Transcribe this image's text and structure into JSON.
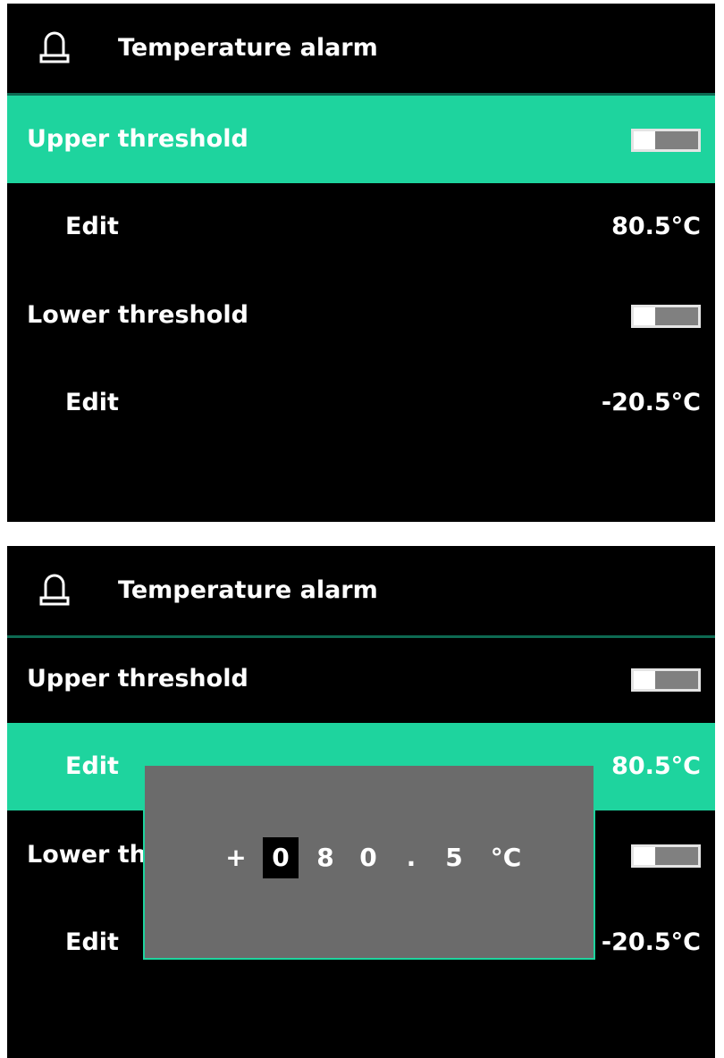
{
  "screens": [
    {
      "header": {
        "title": "Temperature alarm",
        "icon": "bell-icon"
      },
      "rows": [
        {
          "label": "Upper threshold",
          "type": "toggle",
          "enabled": false,
          "active": true
        },
        {
          "label": "Edit",
          "type": "value",
          "value": "80.5°C",
          "active": false
        },
        {
          "label": "Lower threshold",
          "type": "toggle",
          "enabled": false,
          "active": false
        },
        {
          "label": "Edit",
          "type": "value",
          "value": "-20.5°C",
          "active": false
        }
      ]
    },
    {
      "header": {
        "title": "Temperature alarm",
        "icon": "bell-icon"
      },
      "rows": [
        {
          "label": "Upper threshold",
          "type": "toggle",
          "enabled": false,
          "active": false
        },
        {
          "label": "Edit",
          "type": "value",
          "value": "80.5°C",
          "active": true
        },
        {
          "label": "Lower threshold",
          "type": "toggle",
          "enabled": false,
          "active": false
        },
        {
          "label": "Edit",
          "type": "value",
          "value": "-20.5°C",
          "active": false
        }
      ],
      "popup": {
        "digits": [
          "+",
          "0",
          "8",
          "0",
          ".",
          "5",
          "°C"
        ],
        "selected_index": 1
      }
    }
  ],
  "colors": {
    "accent": "#1ed49e",
    "background": "#000000",
    "header_divider": "#0d6a52",
    "popup_background": "#6b6b6b",
    "toggle_off": "#808080",
    "text": "#ffffff"
  }
}
